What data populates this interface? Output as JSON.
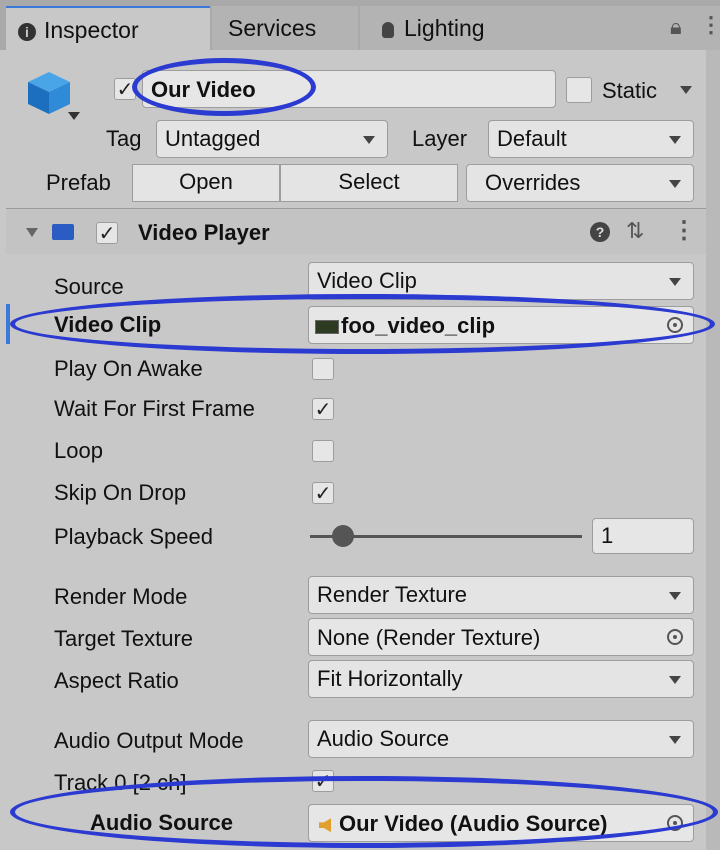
{
  "tabs": [
    {
      "label": "Inspector",
      "icon": "info-icon"
    },
    {
      "label": "Services"
    },
    {
      "label": "Lighting",
      "icon": "lightbulb-icon"
    }
  ],
  "object": {
    "name": "Our Video",
    "static_label": "Static",
    "tag_label": "Tag",
    "tag_value": "Untagged",
    "layer_label": "Layer",
    "layer_value": "Default",
    "prefab_label": "Prefab",
    "open_label": "Open",
    "select_label": "Select",
    "overrides_label": "Overrides"
  },
  "component": {
    "title": "Video Player",
    "enabled": true
  },
  "properties": {
    "source": {
      "label": "Source",
      "value": "Video Clip"
    },
    "video_clip": {
      "label": "Video Clip",
      "value": "foo_video_clip"
    },
    "play_on_awake": {
      "label": "Play On Awake",
      "checked": false
    },
    "wait_first_frame": {
      "label": "Wait For First Frame",
      "checked": true
    },
    "loop": {
      "label": "Loop",
      "checked": false
    },
    "skip_on_drop": {
      "label": "Skip On Drop",
      "checked": true
    },
    "playback_speed": {
      "label": "Playback Speed",
      "value": "1"
    },
    "render_mode": {
      "label": "Render Mode",
      "value": "Render Texture"
    },
    "target_texture": {
      "label": "Target Texture",
      "value": "None (Render Texture)"
    },
    "aspect_ratio": {
      "label": "Aspect Ratio",
      "value": "Fit Horizontally"
    },
    "audio_output_mode": {
      "label": "Audio Output Mode",
      "value": "Audio Source"
    },
    "track": {
      "label": "Track 0 [2 ch]",
      "checked": true
    },
    "audio_source": {
      "label": "Audio Source",
      "value": "Our Video (Audio Source)"
    }
  },
  "colors": {
    "annotation": "#2b3ad0",
    "accent": "#3a79d8"
  }
}
